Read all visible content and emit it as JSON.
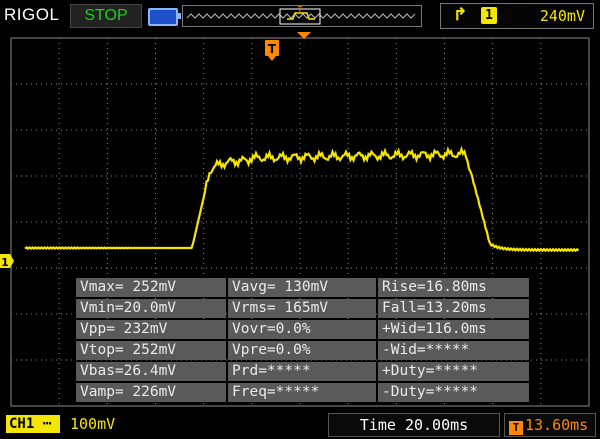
{
  "top_bar": {
    "brand": "RIGOL",
    "run_state": "STOP",
    "trigger": {
      "edge_icon": "rising-edge-icon",
      "channel": "1",
      "level": "240mV"
    }
  },
  "screen": {
    "trigger_marker": "T",
    "channel_marker": "1",
    "colors": {
      "ch1": "#f5e600",
      "trigger": "#ff8800",
      "grid": "#8a8a8a"
    }
  },
  "measurements": {
    "rows": [
      [
        "Vmax= 252mV",
        "Vavg= 130mV",
        "Rise=16.80ms"
      ],
      [
        "Vmin=20.0mV",
        "Vrms= 165mV",
        "Fall=13.20ms"
      ],
      [
        "Vpp= 232mV",
        "Vovr=0.0%",
        "+Wid=116.0ms"
      ],
      [
        "Vtop= 252mV",
        "Vpre=0.0%",
        "-Wid=*****"
      ],
      [
        "Vbas=26.4mV",
        "Prd=*****",
        "+Duty=*****"
      ],
      [
        "Vamp= 226mV",
        "Freq=*****",
        "-Duty=*****"
      ]
    ]
  },
  "bottom_bar": {
    "ch1_label": "CH1",
    "ch1_coupling_icon": "dc-coupling-icon",
    "ch1_scale": "100mV",
    "timebase": "Time 20.00ms",
    "trigger_pos_marker": "T",
    "trigger_pos": "13.60ms"
  }
}
